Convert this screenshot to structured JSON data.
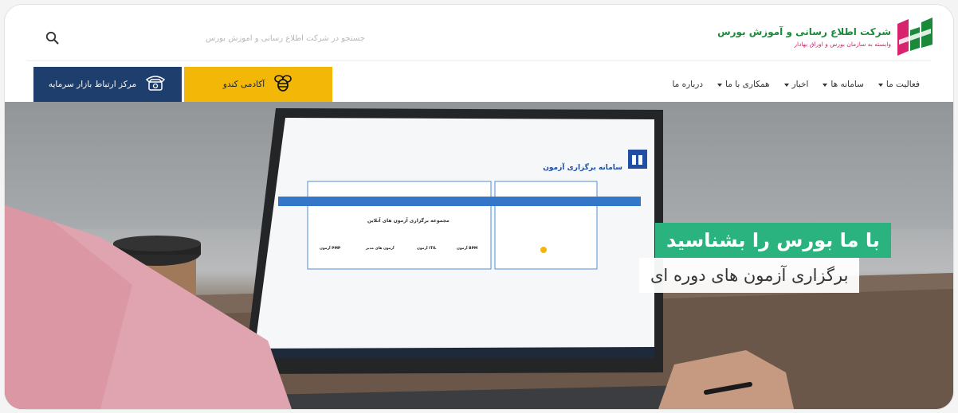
{
  "brand": {
    "name": "شرکت اطلاع رسانی و آموزش بورس",
    "tagline": "وابسته به سازمان بورس و اوراق بهادار",
    "colors": {
      "green": "#1a8a3a",
      "magenta": "#d6246e"
    },
    "icon": "logo-icon"
  },
  "search": {
    "placeholder": "جستجو در شرکت اطلاع رسانی و آموزش بورس",
    "icon": "search-icon"
  },
  "nav": {
    "items": [
      {
        "label": "فعالیت ما",
        "has_dropdown": true
      },
      {
        "label": "سامانه ها",
        "has_dropdown": true
      },
      {
        "label": "اخبار",
        "has_dropdown": true
      },
      {
        "label": "همکاری با ما",
        "has_dropdown": true
      },
      {
        "label": "درباره ما",
        "has_dropdown": false
      }
    ]
  },
  "buttons": {
    "academy": {
      "label": "آکادمی کندو",
      "icon": "bee-icon",
      "color": "#f2b707"
    },
    "call_center": {
      "label": "مرکز ارتباط بازار سرمایه",
      "icon": "telephone-icon",
      "color": "#1e3e6d"
    }
  },
  "hero": {
    "headline": "با ما بورس را بشناسید",
    "subheadline": "برگزاری آزمون های دوره ای",
    "headline_color": "#2ab37f",
    "screen": {
      "app_title": "سامانه برگزاری آزمون",
      "panel_title": "مجموعه برگزاری آزمون های آنلاین",
      "card_labels": [
        "آزمون BPM",
        "آزمون ITIL",
        "آزمون های مدیر",
        "آزمون PMP"
      ]
    }
  }
}
